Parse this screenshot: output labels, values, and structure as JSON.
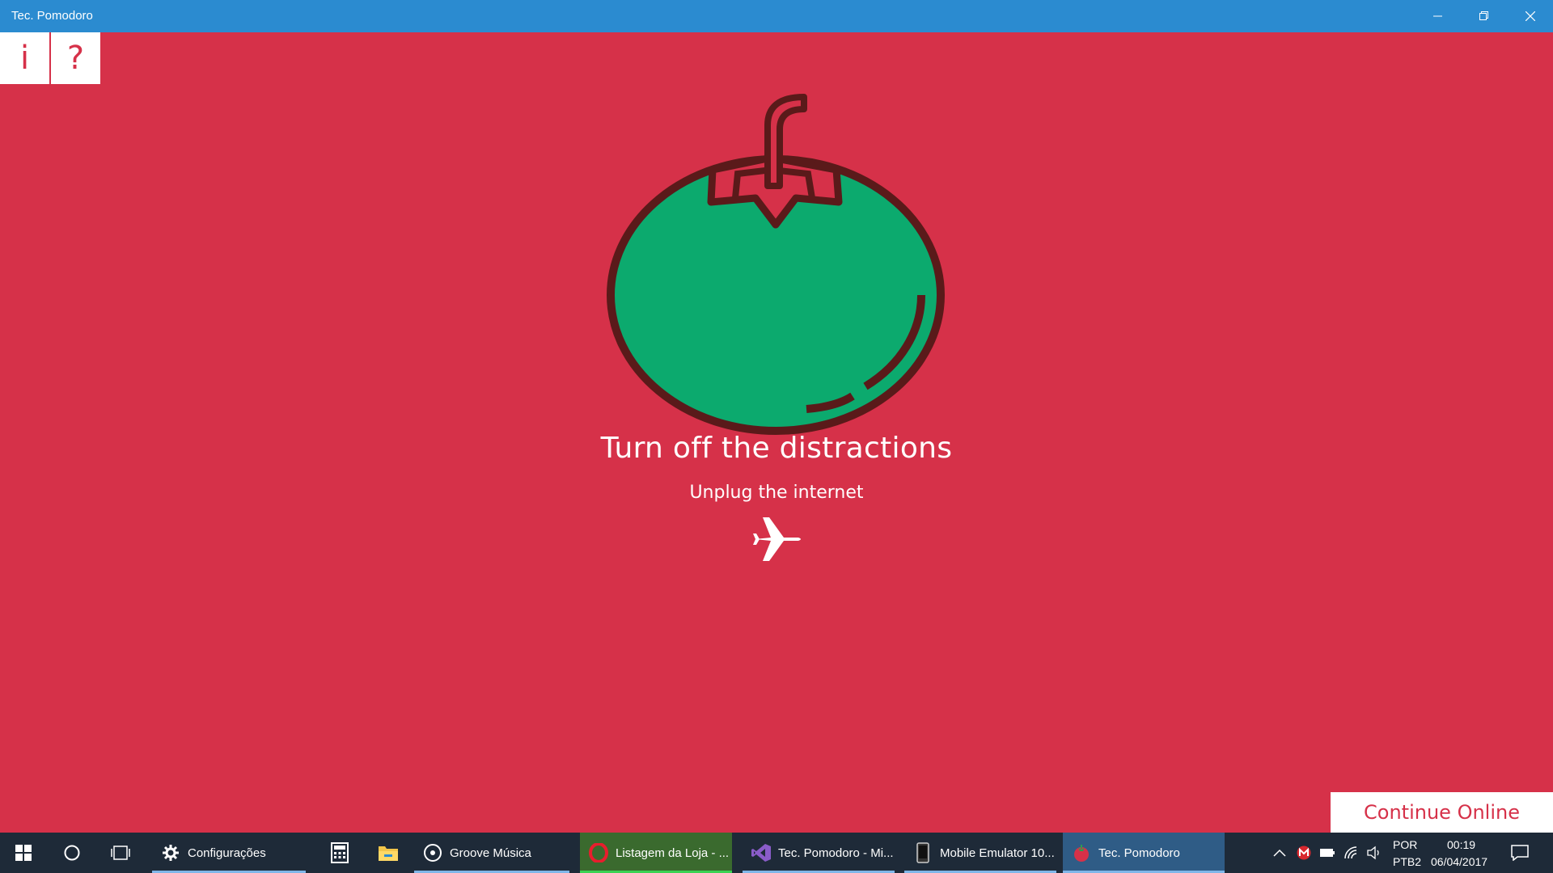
{
  "window": {
    "title": "Tec. Pomodoro",
    "minimize_icon": "minimize-icon",
    "restore_icon": "restore-icon",
    "close_icon": "close-icon"
  },
  "app": {
    "info_button": "i",
    "help_button": "?",
    "illustration": "tomato-icon",
    "headline": "Turn off the distractions",
    "subline": "Unplug the internet",
    "action_icon": "airplane-icon",
    "continue_button": "Continue Online",
    "colors": {
      "background": "#d63149",
      "tomato": "#0caa6e",
      "outline": "#5a1a1a",
      "titlebar": "#2b8bd0"
    }
  },
  "taskbar": {
    "start_icon": "windows-start-icon",
    "search_icon": "cortana-circle-icon",
    "task_view_icon": "task-view-icon",
    "tasks": [
      {
        "label": "Configurações",
        "icon": "gear-icon"
      },
      {
        "label": "",
        "icon": "calculator-icon"
      },
      {
        "label": "",
        "icon": "folder-icon"
      },
      {
        "label": "Groove Música",
        "icon": "groove-music-icon"
      },
      {
        "label": "Listagem da Loja - ...",
        "icon": "opera-icon"
      },
      {
        "label": "Tec. Pomodoro - Mi...",
        "icon": "visual-studio-icon"
      },
      {
        "label": "Mobile Emulator 10...",
        "icon": "phone-icon"
      },
      {
        "label": "Tec. Pomodoro",
        "icon": "tomato-icon"
      }
    ],
    "tray": {
      "language_top": "POR",
      "language_bottom": "PTB2",
      "time": "00:19",
      "date": "06/04/2017"
    }
  }
}
